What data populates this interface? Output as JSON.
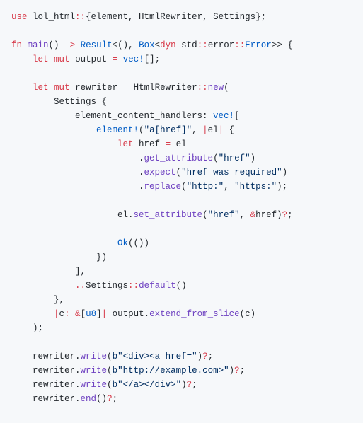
{
  "code": {
    "l1": {
      "a": "use",
      "b": " lol_html",
      "c": "::",
      "d": "{element, HtmlRewriter, Settings};"
    },
    "l2": {
      "a": "fn",
      "b": " ",
      "c": "main",
      "d": "() ",
      "e": "->",
      "f": " ",
      "g": "Result",
      "h": "<(), ",
      "i": "Box",
      "j": "<",
      "k": "dyn",
      "l": " std",
      "m": "::",
      "n": "error",
      "o": "::",
      "p": "Error",
      "q": ">> {"
    },
    "l3": {
      "a": "    ",
      "b": "let",
      "c": " ",
      "d": "mut",
      "e": " output ",
      "f": "=",
      "g": " ",
      "h": "vec!",
      "i": "[];"
    },
    "l4": {
      "a": "    ",
      "b": "let",
      "c": " ",
      "d": "mut",
      "e": " rewriter ",
      "f": "=",
      "g": " HtmlRewriter",
      "h": "::",
      "i": "new",
      "j": "("
    },
    "l5": {
      "a": "        Settings {"
    },
    "l6": {
      "a": "            element_content_handlers: ",
      "b": "vec!",
      "c": "["
    },
    "l7": {
      "a": "                ",
      "b": "element!",
      "c": "(",
      "d": "\"a[href]\"",
      "e": ", ",
      "f": "|",
      "g": "el",
      "h": "|",
      "i": " {"
    },
    "l8": {
      "a": "                    ",
      "b": "let",
      "c": " href ",
      "d": "=",
      "e": " el"
    },
    "l9": {
      "a": "                        .",
      "b": "get_attribute",
      "c": "(",
      "d": "\"href\"",
      "e": ")"
    },
    "l10": {
      "a": "                        .",
      "b": "expect",
      "c": "(",
      "d": "\"href was required\"",
      "e": ")"
    },
    "l11": {
      "a": "                        .",
      "b": "replace",
      "c": "(",
      "d": "\"http:\"",
      "e": ", ",
      "f": "\"https:\"",
      "g": ");"
    },
    "l12": {
      "a": "                    el.",
      "b": "set_attribute",
      "c": "(",
      "d": "\"href\"",
      "e": ", ",
      "f": "&",
      "g": "href)",
      "h": "?",
      "i": ";"
    },
    "l13": {
      "a": "                    ",
      "b": "Ok",
      "c": "(())"
    },
    "l14": {
      "a": "                })"
    },
    "l15": {
      "a": "            ],"
    },
    "l16": {
      "a": "            ",
      "b": "..",
      "c": "Settings",
      "d": "::",
      "e": "default",
      "f": "()"
    },
    "l17": {
      "a": "        },"
    },
    "l18": {
      "a": "        ",
      "b": "|",
      "c": "c",
      "d": ": &",
      "e": "[",
      "f": "u8",
      "g": "]",
      "h": "|",
      "i": " output.",
      "j": "extend_from_slice",
      "k": "(c)"
    },
    "l19": {
      "a": "    );"
    },
    "l20": {
      "a": "    rewriter.",
      "b": "write",
      "c": "(",
      "d": "b\"<div><a href=\"",
      "e": ")",
      "f": "?",
      "g": ";"
    },
    "l21": {
      "a": "    rewriter.",
      "b": "write",
      "c": "(",
      "d": "b\"http://example.com>\"",
      "e": ")",
      "f": "?",
      "g": ";"
    },
    "l22": {
      "a": "    rewriter.",
      "b": "write",
      "c": "(",
      "d": "b\"</a></div>\"",
      "e": ")",
      "f": "?",
      "g": ";"
    },
    "l23": {
      "a": "    rewriter.",
      "b": "end",
      "c": "()",
      "d": "?",
      "e": ";"
    }
  }
}
